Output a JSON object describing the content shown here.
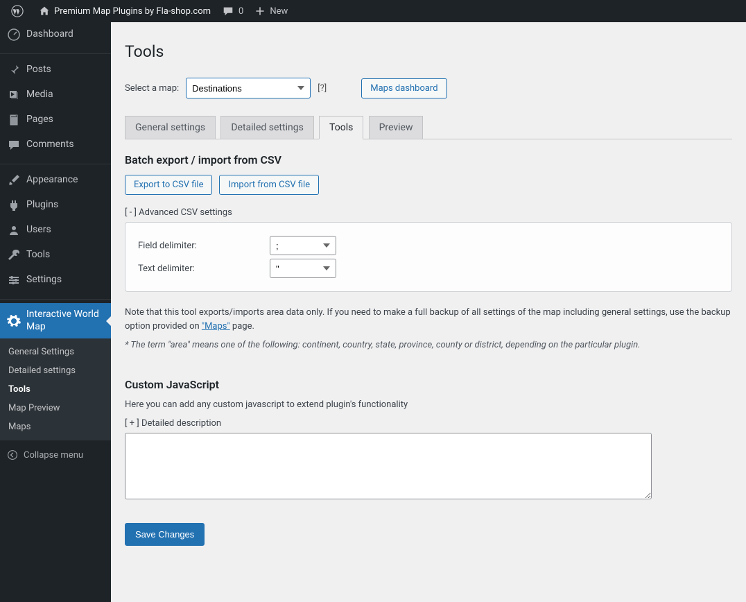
{
  "adminbar": {
    "site_title": "Premium Map Plugins by Fla-shop.com",
    "comments_count": "0",
    "new_label": "New"
  },
  "sidebar": {
    "items": [
      {
        "id": "dashboard",
        "label": "Dashboard"
      },
      {
        "id": "posts",
        "label": "Posts"
      },
      {
        "id": "media",
        "label": "Media"
      },
      {
        "id": "pages",
        "label": "Pages"
      },
      {
        "id": "comments",
        "label": "Comments"
      },
      {
        "id": "appearance",
        "label": "Appearance"
      },
      {
        "id": "plugins",
        "label": "Plugins"
      },
      {
        "id": "users",
        "label": "Users"
      },
      {
        "id": "tools",
        "label": "Tools"
      },
      {
        "id": "settings",
        "label": "Settings"
      },
      {
        "id": "iwm",
        "label": "Interactive World Map"
      }
    ],
    "submenu": [
      {
        "label": "General Settings"
      },
      {
        "label": "Detailed settings"
      },
      {
        "label": "Tools"
      },
      {
        "label": "Map Preview"
      },
      {
        "label": "Maps"
      }
    ],
    "collapse": "Collapse menu"
  },
  "page": {
    "title": "Tools",
    "select_label": "Select a map:",
    "selected_map": "Destinations",
    "help": "[?]",
    "dashboard_btn": "Maps dashboard",
    "tabs": [
      {
        "label": "General settings"
      },
      {
        "label": "Detailed settings"
      },
      {
        "label": "Tools"
      },
      {
        "label": "Preview"
      }
    ],
    "csv": {
      "heading": "Batch export / import from CSV",
      "export_btn": "Export to CSV file",
      "import_btn": "Import from CSV file",
      "adv_toggle": "[ - ]  Advanced CSV settings",
      "field_delim_label": "Field delimiter:",
      "field_delim_value": ";",
      "text_delim_label": "Text delimiter:",
      "text_delim_value": "\""
    },
    "note_pre": "Note that this tool exports/imports area data only. If you need to make a full backup of all settings of the map including general settings, use the backup option provided on ",
    "note_link": "\"Maps\"",
    "note_post": " page.",
    "note_italic": "* The term \"area\" means one of the following: continent, country, state, province, county or district, depending on the particular plugin.",
    "js": {
      "heading": "Custom JavaScript",
      "desc": "Here you can add any custom javascript to extend plugin's functionality",
      "toggle": "[ + ]  Detailed description",
      "value": ""
    },
    "save_btn": "Save Changes"
  }
}
